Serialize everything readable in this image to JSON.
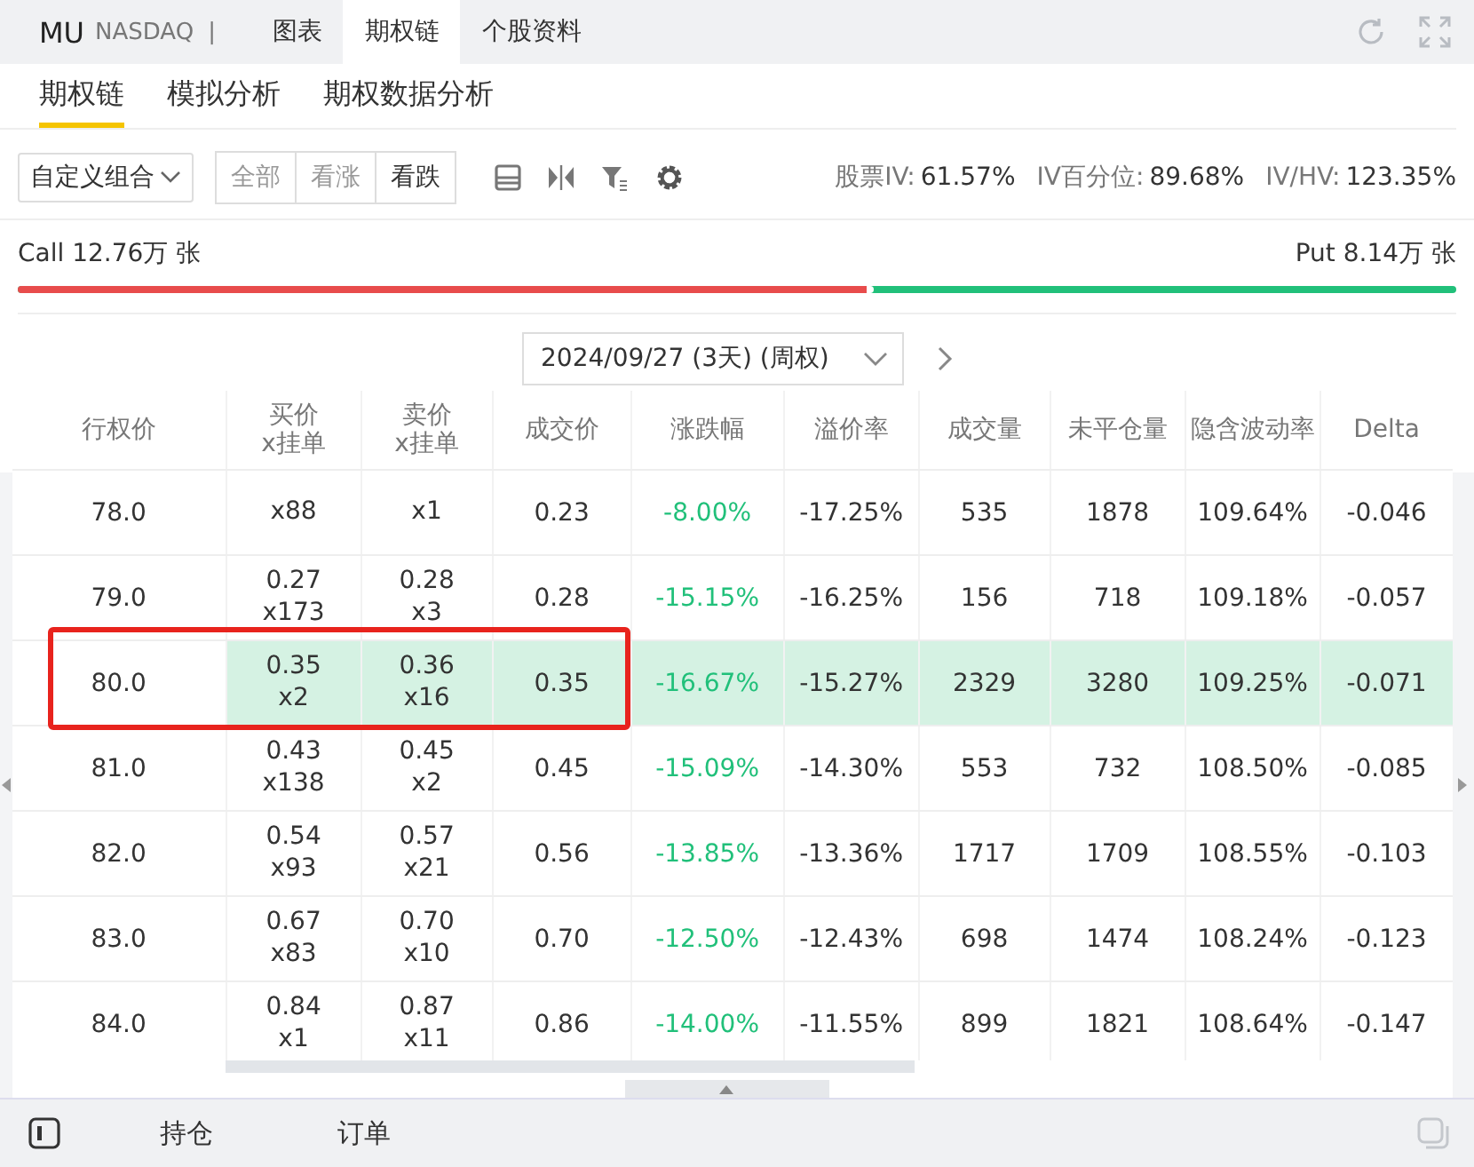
{
  "header": {
    "symbol": "MU",
    "exchange": "NASDAQ",
    "separator": "|",
    "tabs": [
      {
        "label": "图表",
        "selected": false
      },
      {
        "label": "期权链",
        "selected": true
      },
      {
        "label": "个股资料",
        "selected": false
      }
    ]
  },
  "subtabs": [
    {
      "label": "期权链",
      "selected": true
    },
    {
      "label": "模拟分析",
      "selected": false
    },
    {
      "label": "期权数据分析",
      "selected": false
    }
  ],
  "toolbar": {
    "combo": "自定义组合",
    "filters": [
      {
        "label": "全部",
        "selected": false
      },
      {
        "label": "看涨",
        "selected": false
      },
      {
        "label": "看跌",
        "selected": true
      }
    ],
    "stats": [
      {
        "label": "股票IV:",
        "value": "61.57%"
      },
      {
        "label": "IV百分位:",
        "value": "89.68%"
      },
      {
        "label": "IV/HV:",
        "value": "123.35%"
      }
    ]
  },
  "volume": {
    "call": "Call 12.76万 张",
    "put": "Put 8.14万 张",
    "level": 0.595
  },
  "expiry": "2024/09/27 (3天) (周权)",
  "table": {
    "columns": [
      "行权价",
      "买价\nx挂单",
      "卖价\nx挂单",
      "成交价",
      "涨跌幅",
      "溢价率",
      "成交量",
      "未平仓量",
      "隐含波动率",
      "Delta"
    ],
    "rows": [
      {
        "strike": "78.0",
        "bid": "",
        "bid_size": "x88",
        "ask": "",
        "ask_size": "x1",
        "last": "0.23",
        "change": "-8.00%",
        "premium": "-17.25%",
        "volume": "535",
        "open_interest": "1878",
        "iv": "109.64%",
        "delta": "-0.046",
        "selected": false
      },
      {
        "strike": "79.0",
        "bid": "0.27",
        "bid_size": "x173",
        "ask": "0.28",
        "ask_size": "x3",
        "last": "0.28",
        "change": "-15.15%",
        "premium": "-16.25%",
        "volume": "156",
        "open_interest": "718",
        "iv": "109.18%",
        "delta": "-0.057",
        "selected": false
      },
      {
        "strike": "80.0",
        "bid": "0.35",
        "bid_size": "x2",
        "ask": "0.36",
        "ask_size": "x16",
        "last": "0.35",
        "change": "-16.67%",
        "premium": "-15.27%",
        "volume": "2329",
        "open_interest": "3280",
        "iv": "109.25%",
        "delta": "-0.071",
        "selected": true
      },
      {
        "strike": "81.0",
        "bid": "0.43",
        "bid_size": "x138",
        "ask": "0.45",
        "ask_size": "x2",
        "last": "0.45",
        "change": "-15.09%",
        "premium": "-14.30%",
        "volume": "553",
        "open_interest": "732",
        "iv": "108.50%",
        "delta": "-0.085",
        "selected": false
      },
      {
        "strike": "82.0",
        "bid": "0.54",
        "bid_size": "x93",
        "ask": "0.57",
        "ask_size": "x21",
        "last": "0.56",
        "change": "-13.85%",
        "premium": "-13.36%",
        "volume": "1717",
        "open_interest": "1709",
        "iv": "108.55%",
        "delta": "-0.103",
        "selected": false
      },
      {
        "strike": "83.0",
        "bid": "0.67",
        "bid_size": "x83",
        "ask": "0.70",
        "ask_size": "x10",
        "last": "0.70",
        "change": "-12.50%",
        "premium": "-12.43%",
        "volume": "698",
        "open_interest": "1474",
        "iv": "108.24%",
        "delta": "-0.123",
        "selected": false
      },
      {
        "strike": "84.0",
        "bid": "0.84",
        "bid_size": "x1",
        "ask": "0.87",
        "ask_size": "x11",
        "last": "0.86",
        "change": "-14.00%",
        "premium": "-11.55%",
        "volume": "899",
        "open_interest": "1821",
        "iv": "108.64%",
        "delta": "-0.147",
        "selected": false
      }
    ]
  },
  "bottom_tabs": [
    {
      "label": "持仓"
    },
    {
      "label": "订单"
    }
  ]
}
